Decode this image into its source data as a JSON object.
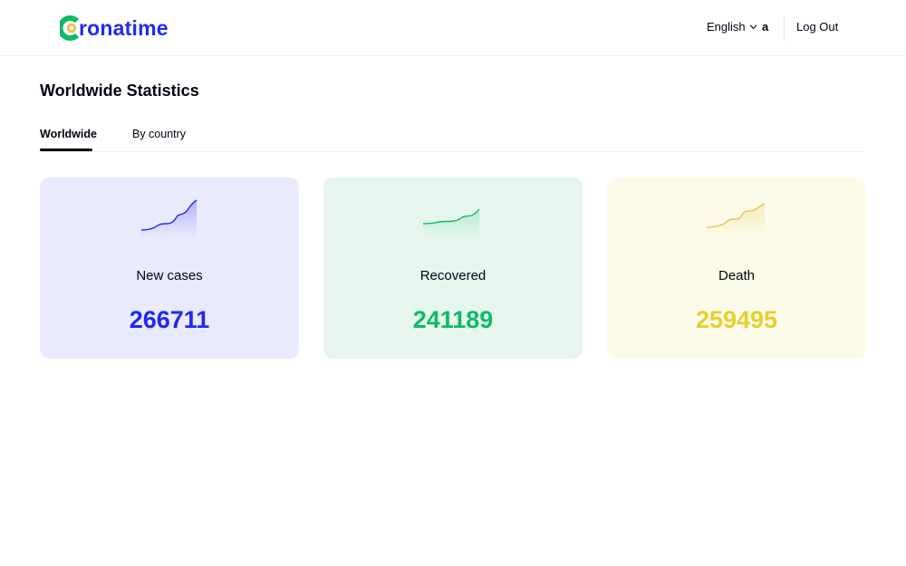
{
  "header": {
    "logo_text": "ronatime",
    "language": "English",
    "user_name": "a",
    "logout_label": "Log Out"
  },
  "page_title": "Worldwide Statistics",
  "tabs": [
    {
      "label": "Worldwide",
      "active": true
    },
    {
      "label": "By country",
      "active": false
    }
  ],
  "colors": {
    "brand": "#2029f3",
    "green": "#0fba68",
    "yellow": "#eac451",
    "text": "#010414"
  },
  "cards": [
    {
      "label": "New cases",
      "value": "266711",
      "color": "#2029f3",
      "background": "#e9eafc",
      "icon": "trend-line-icon"
    },
    {
      "label": "Recovered",
      "value": "241189",
      "color": "#0fba68",
      "background": "#e6f6ee",
      "icon": "trend-line-icon"
    },
    {
      "label": "Death",
      "value": "259495",
      "color": "#e6cf2e",
      "background": "#fcfbe9",
      "icon": "trend-line-icon"
    }
  ]
}
